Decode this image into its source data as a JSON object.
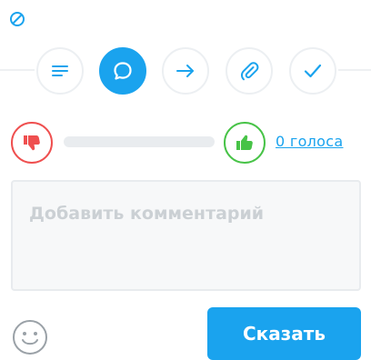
{
  "top_icon": {
    "name": "disabled-icon",
    "color": "#1aa3ee"
  },
  "tools": [
    {
      "name": "text-lines-icon",
      "active": false
    },
    {
      "name": "comment-bubble-icon",
      "active": true
    },
    {
      "name": "arrow-right-icon",
      "active": false
    },
    {
      "name": "paperclip-icon",
      "active": false
    },
    {
      "name": "checkmark-icon",
      "active": false
    }
  ],
  "voting": {
    "down_icon": "thumbs-down-icon",
    "up_icon": "thumbs-up-icon",
    "votes_label": "0 голоса",
    "down_color": "#ef4f4f",
    "up_color": "#47c347"
  },
  "comment": {
    "placeholder": "Добавить комментарий",
    "value": ""
  },
  "footer": {
    "emoji_icon": "smiley-icon",
    "send_label": "Сказать",
    "accent": "#1aa3ee"
  }
}
